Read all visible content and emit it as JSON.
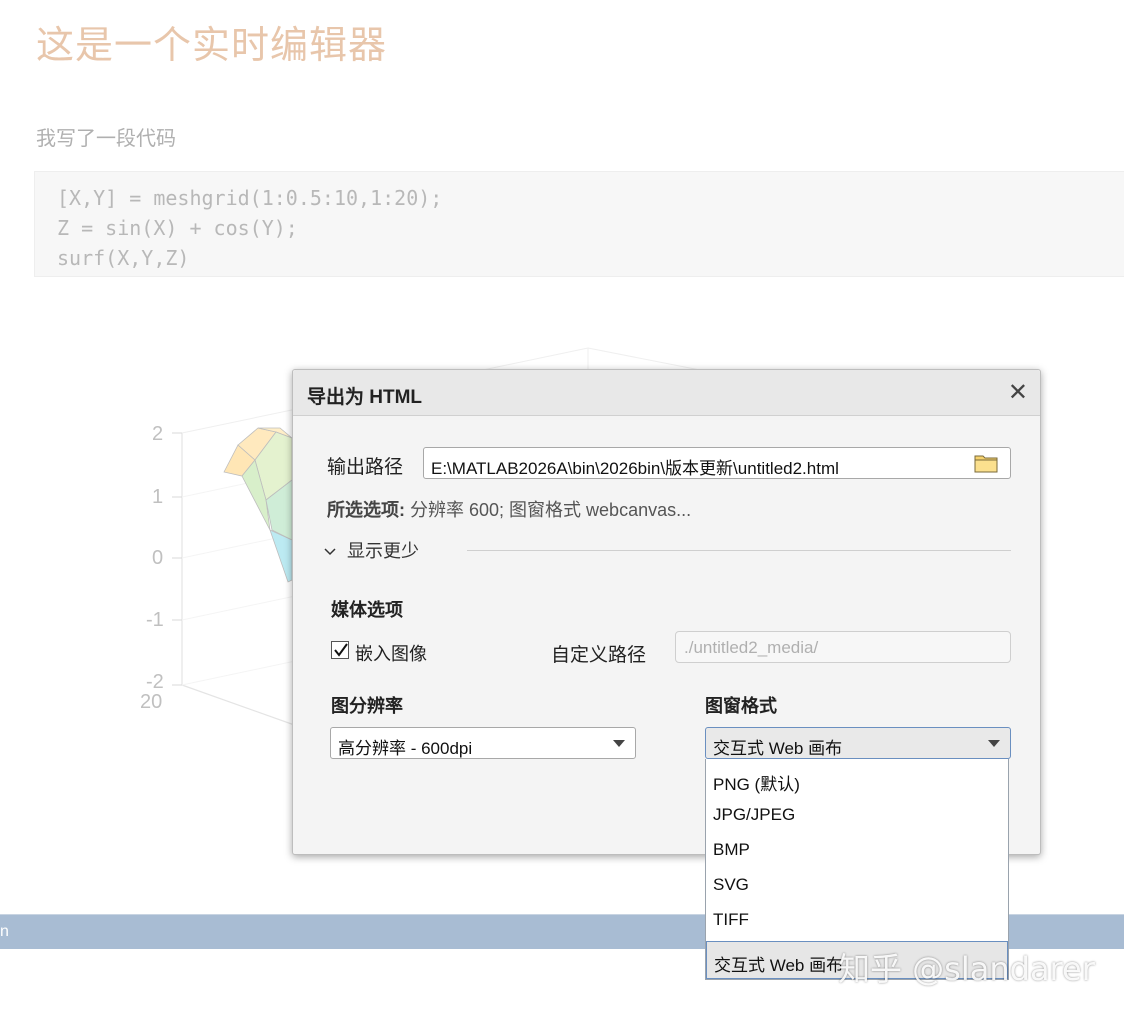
{
  "document": {
    "heading": "这是一个实时编辑器",
    "paragraph": "我写了一段代码",
    "code_lines": [
      "[X,Y] = meshgrid(1:0.5:10,1:20);",
      "Z = sin(X) + cos(Y);",
      "surf(X,Y,Z)"
    ]
  },
  "plot": {
    "z_ticks": [
      "2",
      "1",
      "0",
      "-1",
      "-2"
    ],
    "y_tick": "20"
  },
  "statusbar": {
    "text": "n"
  },
  "dialog": {
    "title": "导出为 HTML",
    "close_icon": "close-icon",
    "output_path_label": "输出路径",
    "output_path_value": "E:\\MATLAB2026A\\bin\\2026bin\\版本更新\\untitled2.html",
    "folder_icon": "folder-icon",
    "selected_options_label": "所选选项:",
    "selected_options_value": "分辨率 600; 图窗格式 webcanvas...",
    "show_less_label": "显示更少",
    "media_section": "媒体选项",
    "embed_images_label": "嵌入图像",
    "embed_images_checked": true,
    "custom_path_label": "自定义路径",
    "custom_path_placeholder": "./untitled2_media/",
    "resolution_section": "图分辨率",
    "resolution_value": "高分辨率 - 600dpi",
    "figure_format_section": "图窗格式",
    "figure_format_value": "交互式 Web 画布",
    "figure_format_options": [
      "PNG (默认)",
      "JPG/JPEG",
      "BMP",
      "SVG",
      "TIFF",
      "交互式 Web 画布"
    ],
    "selected_option_index": 5
  },
  "watermark": "知乎 @slandarer",
  "colors": {
    "heading": "#e8c6ab",
    "statusbar": "#a8bcd3",
    "dropdown_highlight_border": "#6a8fc0"
  }
}
